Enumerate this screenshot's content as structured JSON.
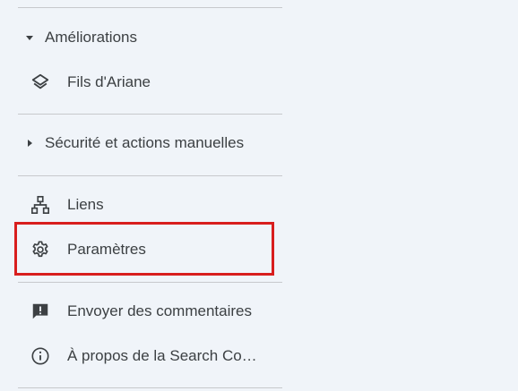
{
  "sidebar": {
    "ameliorations": {
      "label": "Améliorations",
      "caret_icon": "caret-down-icon",
      "items": [
        {
          "label": "Fils d'Ariane",
          "icon": "layers-icon"
        }
      ]
    },
    "securite": {
      "label": "Sécurité et actions manuelles",
      "caret_icon": "caret-right-icon"
    },
    "main_items": [
      {
        "label": "Liens",
        "icon": "sitemap-icon"
      },
      {
        "label": "Paramètres",
        "icon": "gear-icon"
      }
    ],
    "footer_items": [
      {
        "label": "Envoyer des commentaires",
        "icon": "feedback-icon"
      },
      {
        "label": "À propos de la Search Console",
        "icon": "info-icon"
      }
    ]
  },
  "highlight": {
    "target": "Paramètres",
    "color": "#d81e1e"
  },
  "colors": {
    "background": "#f0f4f9",
    "text": "#3c4043",
    "divider": "#c7c9cc"
  }
}
